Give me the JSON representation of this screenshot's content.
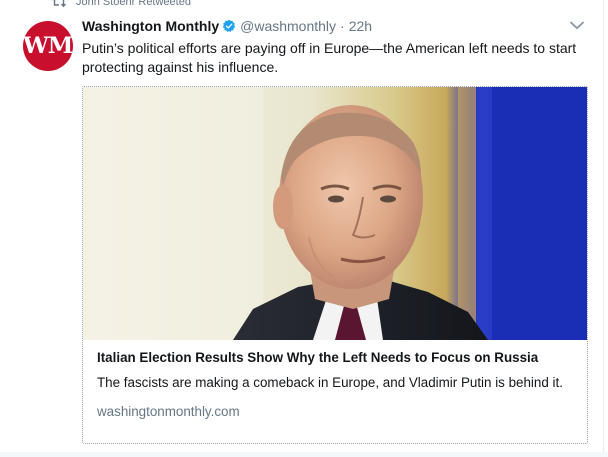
{
  "retweet_context": {
    "text": "John Stoehr Retweeted"
  },
  "author": {
    "avatar_text": "WM",
    "display_name": "Washington Monthly",
    "screen_name": "@washmonthly",
    "separator": "·",
    "timestamp": "22h",
    "verified": true
  },
  "tweet": {
    "text": "Putin’s political efforts are paying off in Europe—the American left needs to start protecting against his influence."
  },
  "card": {
    "image_alt": "Vladimir Putin portrait",
    "title": "Italian Election Results Show Why the Left Needs to Focus on Russia",
    "description": "The fascists are making a comeback in Europe, and Vladimir Putin is behind it.",
    "domain": "washingtonmonthly.com"
  },
  "icons": {
    "retweet": "retweet-icon",
    "verified": "verified-badge-icon",
    "menu": "chevron-down-icon"
  },
  "colors": {
    "text_primary": "#14171a",
    "text_secondary": "#657786",
    "verified_blue": "#1da1f2",
    "avatar_red": "#c8102e",
    "flag_blue": "#1a2db5"
  }
}
